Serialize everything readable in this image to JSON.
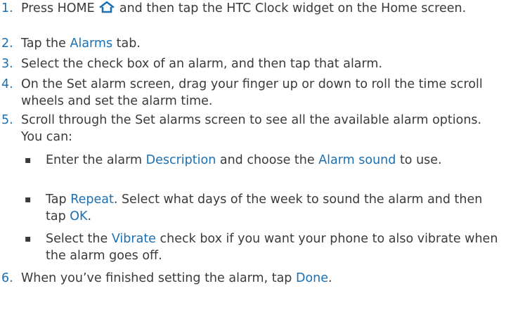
{
  "steps": [
    {
      "num": "1.",
      "parts": [
        {
          "t": "Press HOME "
        },
        {
          "icon": "home-icon"
        },
        {
          "t": " and then tap the HTC Clock widget on the Home screen."
        }
      ]
    },
    {
      "num": "2.",
      "parts": [
        {
          "t": "Tap the "
        },
        {
          "term": "Alarms"
        },
        {
          "t": " tab."
        }
      ]
    },
    {
      "num": "3.",
      "parts": [
        {
          "t": "Select the check box of an alarm, and then tap that alarm."
        }
      ]
    },
    {
      "num": "4.",
      "parts": [
        {
          "t": "On the Set alarm screen, drag your finger up or down to roll the time scroll wheels and set the alarm time."
        }
      ]
    },
    {
      "num": "5.",
      "parts": [
        {
          "t": "Scroll through the Set alarms screen to see all the available alarm options. You can:"
        }
      ],
      "bullets": [
        [
          {
            "t": "Enter the alarm "
          },
          {
            "term": "Description"
          },
          {
            "t": " and choose the "
          },
          {
            "term": "Alarm sound"
          },
          {
            "t": " to use."
          }
        ],
        [
          {
            "t": "Tap "
          },
          {
            "term": "Repeat"
          },
          {
            "t": ". Select what days of the week to sound the alarm and then tap "
          },
          {
            "term": "OK"
          },
          {
            "t": "."
          }
        ],
        [
          {
            "t": "Select the "
          },
          {
            "term": "Vibrate"
          },
          {
            "t": " check box if you want your phone to also vibrate when the alarm goes off."
          }
        ]
      ]
    },
    {
      "num": "6.",
      "parts": [
        {
          "t": "When you’ve finished setting the alarm, tap "
        },
        {
          "term": "Done"
        },
        {
          "t": "."
        }
      ]
    }
  ],
  "colors": {
    "accent": "#1c6fb0",
    "text": "#3a3a3a"
  }
}
